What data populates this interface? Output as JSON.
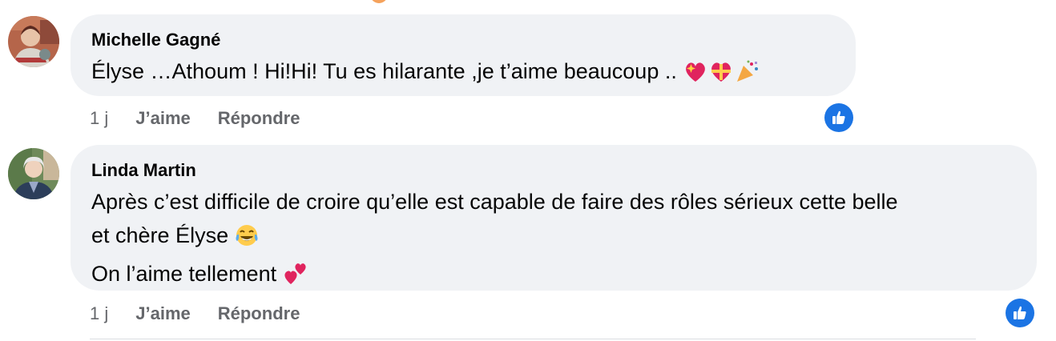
{
  "comments": [
    {
      "author": "Michelle Gagné",
      "lines": [
        "Élyse …Athoum ! Hi!Hi! Tu es hilarante ,je t’aime beaucoup .."
      ],
      "emojis_line1": [
        "sparkling-heart-emoji",
        "heart-with-ribbon-emoji",
        "party-popper-emoji"
      ],
      "time": "1 j",
      "like_label": "J’aime",
      "reply_label": "Répondre",
      "reaction": "like-icon"
    },
    {
      "author": "Linda Martin",
      "lines": [
        "Après c’est difficile de croire qu’elle est capable de faire des rôles sérieux cette belle",
        "et chère Élyse",
        "On l’aime tellement"
      ],
      "emojis_line2": [
        "tears-of-joy-emoji"
      ],
      "emojis_line3": [
        "two-hearts-emoji"
      ],
      "time": "1 j",
      "like_label": "J’aime",
      "reply_label": "Répondre",
      "reaction": "like-icon"
    }
  ],
  "colors": {
    "bubble": "#f0f2f5",
    "meta_text": "#65676b",
    "like_blue": "#1b74e4"
  }
}
